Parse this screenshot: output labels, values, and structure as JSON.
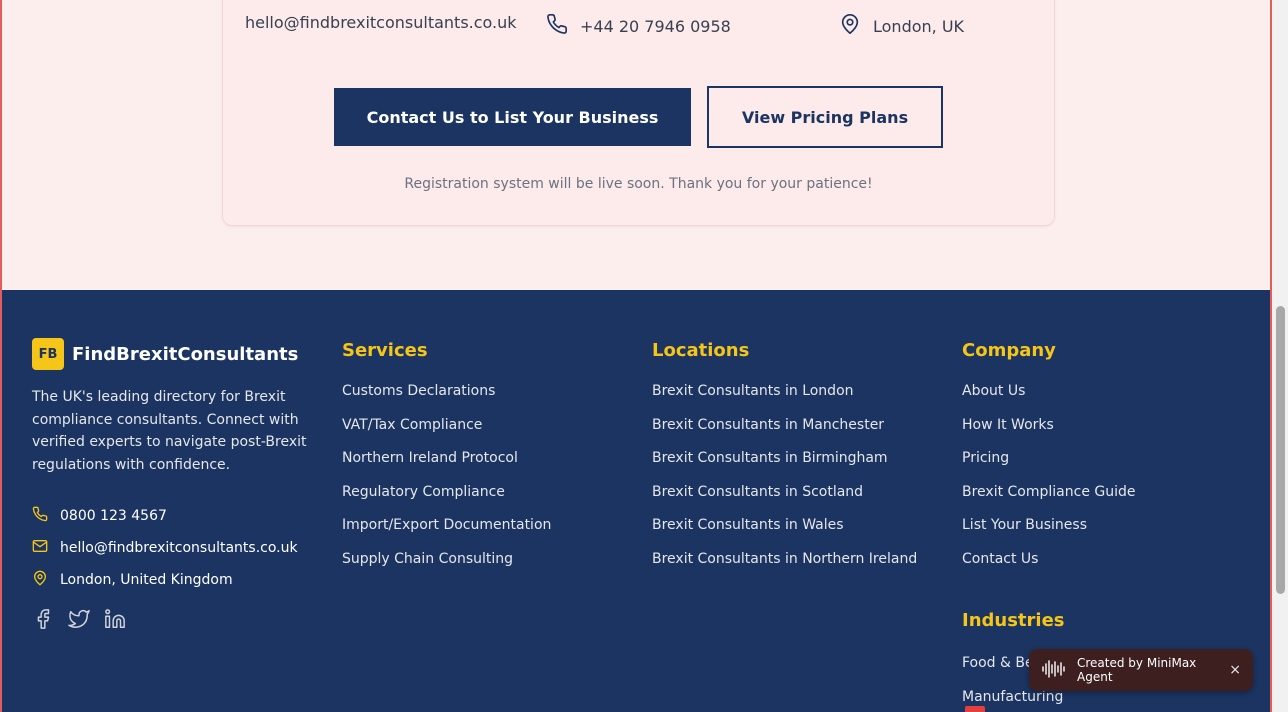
{
  "contact_card": {
    "email": "hello@findbrexitconsultants.co.uk",
    "phone": "+44 20 7946 0958",
    "location": "London, UK",
    "primary_button": "Contact Us to List Your Business",
    "secondary_button": "View Pricing Plans",
    "note": "Registration system will be live soon. Thank you for your patience!"
  },
  "footer": {
    "brand": {
      "logo": "FB",
      "name": "FindBrexitConsultants",
      "description": "The UK's leading directory for Brexit compliance consultants. Connect with verified experts to navigate post-Brexit regulations with confidence."
    },
    "contact": {
      "phone": "0800 123 4567",
      "email": "hello@findbrexitconsultants.co.uk",
      "location": "London, United Kingdom"
    },
    "socials": [
      "facebook-icon",
      "twitter-icon",
      "linkedin-icon"
    ],
    "services": {
      "title": "Services",
      "items": [
        "Customs Declarations",
        "VAT/Tax Compliance",
        "Northern Ireland Protocol",
        "Regulatory Compliance",
        "Import/Export Documentation",
        "Supply Chain Consulting"
      ]
    },
    "locations": {
      "title": "Locations",
      "items": [
        "Brexit Consultants in London",
        "Brexit Consultants in Manchester",
        "Brexit Consultants in Birmingham",
        "Brexit Consultants in Scotland",
        "Brexit Consultants in Wales",
        "Brexit Consultants in Northern Ireland"
      ]
    },
    "company": {
      "title": "Company",
      "items": [
        "About Us",
        "How It Works",
        "Pricing",
        "Brexit Compliance Guide",
        "List Your Business",
        "Contact Us"
      ]
    },
    "industries": {
      "title": "Industries",
      "items": [
        "Food & Be",
        "Manufacturing"
      ]
    }
  },
  "badge": {
    "text": "Created by MiniMax Agent",
    "close": "×"
  },
  "colors": {
    "accent": "#f5c518",
    "navy": "#1b3461"
  }
}
